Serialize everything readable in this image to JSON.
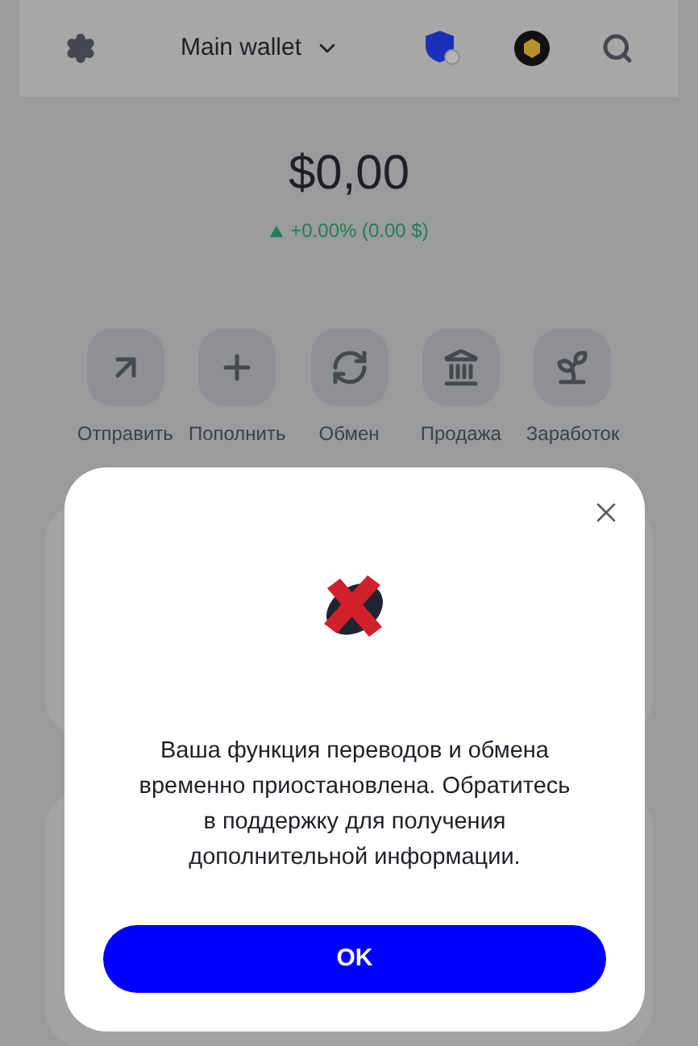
{
  "header": {
    "wallet_name": "Main wallet"
  },
  "balance": {
    "amount": "$0,00",
    "change": "+0.00% (0.00 $)",
    "rising": true
  },
  "actions": [
    {
      "kind": "send",
      "label": "Отправить"
    },
    {
      "kind": "deposit",
      "label": "Пополнить"
    },
    {
      "kind": "swap",
      "label": "Обмен"
    },
    {
      "kind": "sell",
      "label": "Продажа"
    },
    {
      "kind": "earn",
      "label": "Заработок"
    }
  ],
  "dialog": {
    "message": "Ваша функция переводов и обмена временно приостановлена. Обратитесь в поддержку для получения дополнительной информации.",
    "button": "OK"
  }
}
